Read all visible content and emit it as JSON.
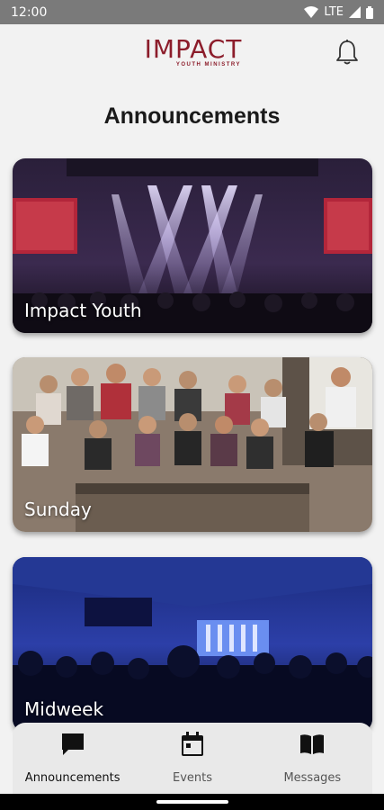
{
  "status": {
    "time": "12:00",
    "network": "LTE"
  },
  "header": {
    "logo_main": "IMPACT",
    "logo_sub": "YOUTH MINISTRY"
  },
  "page": {
    "title": "Announcements"
  },
  "cards": [
    {
      "label": "Impact Youth"
    },
    {
      "label": "Sunday"
    },
    {
      "label": "Midweek"
    }
  ],
  "nav": [
    {
      "label": "Announcements",
      "icon": "chat-bubble-icon",
      "active": true
    },
    {
      "label": "Events",
      "icon": "calendar-icon",
      "active": false
    },
    {
      "label": "Messages",
      "icon": "open-book-icon",
      "active": false
    }
  ],
  "colors": {
    "brand": "#8c1d2b",
    "statusbar": "#7a7a7a",
    "background": "#f2f2f2"
  }
}
